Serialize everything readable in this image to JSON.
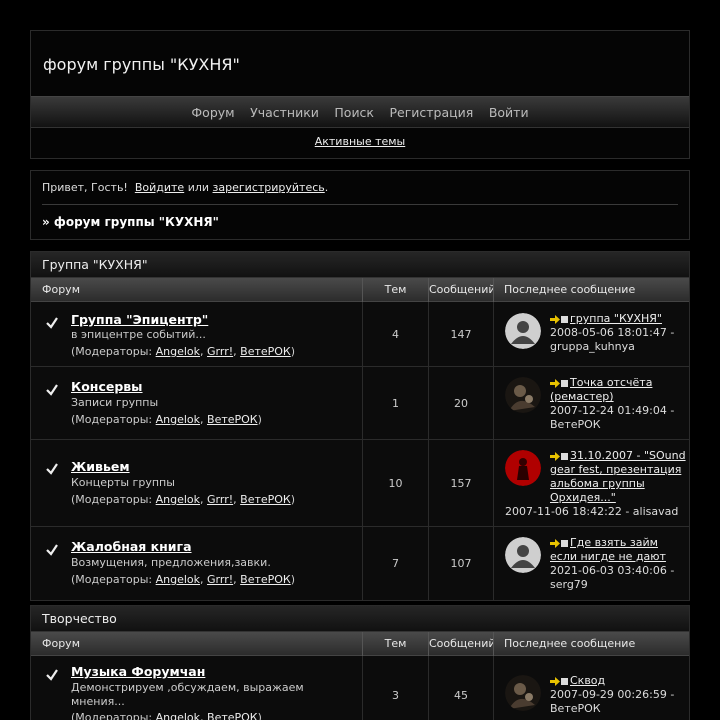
{
  "header": {
    "title": "форум группы \"КУХНЯ\"",
    "nav": [
      "Форум",
      "Участники",
      "Поиск",
      "Регистрация",
      "Войти"
    ],
    "active_topics": "Активные темы"
  },
  "welcome": {
    "greeting": "Привет, Гость!",
    "login": "Войдите",
    "or": "или",
    "register": "зарегистрируйтесь",
    "period": ".",
    "crumb": "» форум группы \"КУХНЯ\""
  },
  "columns": {
    "forum": "Форум",
    "topics": "Тем",
    "posts": "Сообщений",
    "last": "Последнее сообщение"
  },
  "mods_prefix": "(Модераторы:",
  "categories": [
    {
      "title": "Группа \"КУХНЯ\"",
      "forums": [
        {
          "name": "Группа \"Эпицентр\"",
          "desc": "в эпицентре событий...",
          "mods": [
            "Angelok",
            "Grrr!",
            "ВетеРОК"
          ],
          "topics": "4",
          "posts": "147",
          "last_title": "группа \"КУХНЯ\"",
          "last_date": "2008-05-06 18:01:47",
          "last_author": "gruppa_kuhnya",
          "avatar": "default"
        },
        {
          "name": "Консервы",
          "desc": "Записи группы",
          "mods": [
            "Angelok",
            "ВетеРОК"
          ],
          "topics": "1",
          "posts": "20",
          "last_title": "Точка отсчёта (ремастер)",
          "last_date": "2007-12-24 01:49:04",
          "last_author": "ВетеРОК",
          "avatar": "dark"
        },
        {
          "name": "Живьем",
          "desc": "Концерты группы",
          "mods": [
            "Angelok",
            "Grrr!",
            "ВетеРОК"
          ],
          "topics": "10",
          "posts": "157",
          "last_title": "31.10.2007 - \"SOund gear fest, презентация альбома группы Орхидея...\"",
          "last_date": "2007-11-06 18:42:22",
          "last_author": "alisavad",
          "avatar": "red"
        },
        {
          "name": "Жалобная книга",
          "desc": "Возмущения, предложения,завки.",
          "mods": [
            "Angelok",
            "Grrr!",
            "ВетеРОК"
          ],
          "topics": "7",
          "posts": "107",
          "last_title": "Где взять займ если нигде не дают",
          "last_date": "2021-06-03 03:40:06",
          "last_author": "serg79",
          "avatar": "default"
        }
      ]
    },
    {
      "title": "Творчество",
      "forums": [
        {
          "name": "Музыка Форумчан",
          "desc": "Демонстрируем ,обсуждаем, выражаем мнения...",
          "mods": [
            "Angelok",
            "ВетеРОК"
          ],
          "topics": "3",
          "posts": "45",
          "last_title": "Сквод",
          "last_date": "2007-09-29 00:26:59",
          "last_author": "ВетеРОК",
          "avatar": "dark"
        }
      ]
    }
  ],
  "colors": {
    "background": "#000000",
    "panel": "#0c0c0c",
    "border": "#2b2b2b",
    "header_gradient_top": "#4a4a4a",
    "accent_arrow": "#e8c200",
    "avatar_red": "#b00000"
  }
}
